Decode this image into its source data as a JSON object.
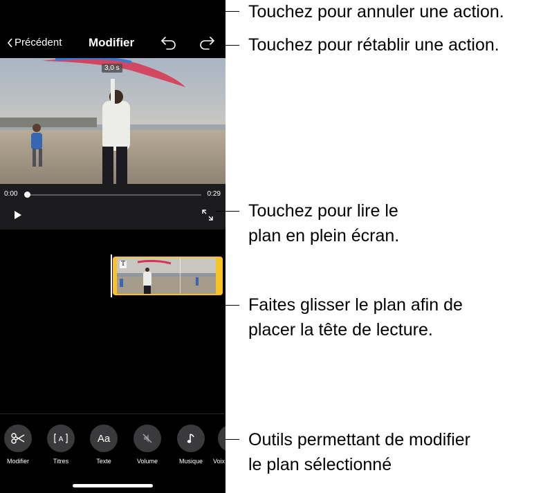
{
  "nav": {
    "back_label": "Précédent",
    "title": "Modifier"
  },
  "video": {
    "duration_badge": "3,0 s"
  },
  "player": {
    "time_start": "0:00",
    "time_end": "0:29",
    "progress": 0
  },
  "clip": {
    "title_marker": "T"
  },
  "tools": [
    {
      "label": "Modifier",
      "icon": "scissors-icon"
    },
    {
      "label": "Titres",
      "icon": "titles-icon"
    },
    {
      "label": "Texte",
      "icon": "text-icon",
      "glyph": "Aa"
    },
    {
      "label": "Volume",
      "icon": "volume-muted-icon"
    },
    {
      "label": "Musique",
      "icon": "music-note-icon"
    },
    {
      "label": "Voix",
      "icon": "microphone-icon"
    }
  ],
  "callouts": {
    "undo": "Touchez pour annuler une action.",
    "redo": "Touchez pour rétablir une action.",
    "fullscreen": [
      "Touchez pour lire le",
      "plan en plein écran."
    ],
    "playhead": [
      "Faites glisser le plan afin de",
      "placer la tête de lecture."
    ],
    "tools": [
      "Outils permettant de modifier",
      "le plan sélectionné"
    ]
  },
  "colors": {
    "clip_border": "#f7c325",
    "background": "#000000",
    "controls_bg": "#1c1c1e"
  }
}
